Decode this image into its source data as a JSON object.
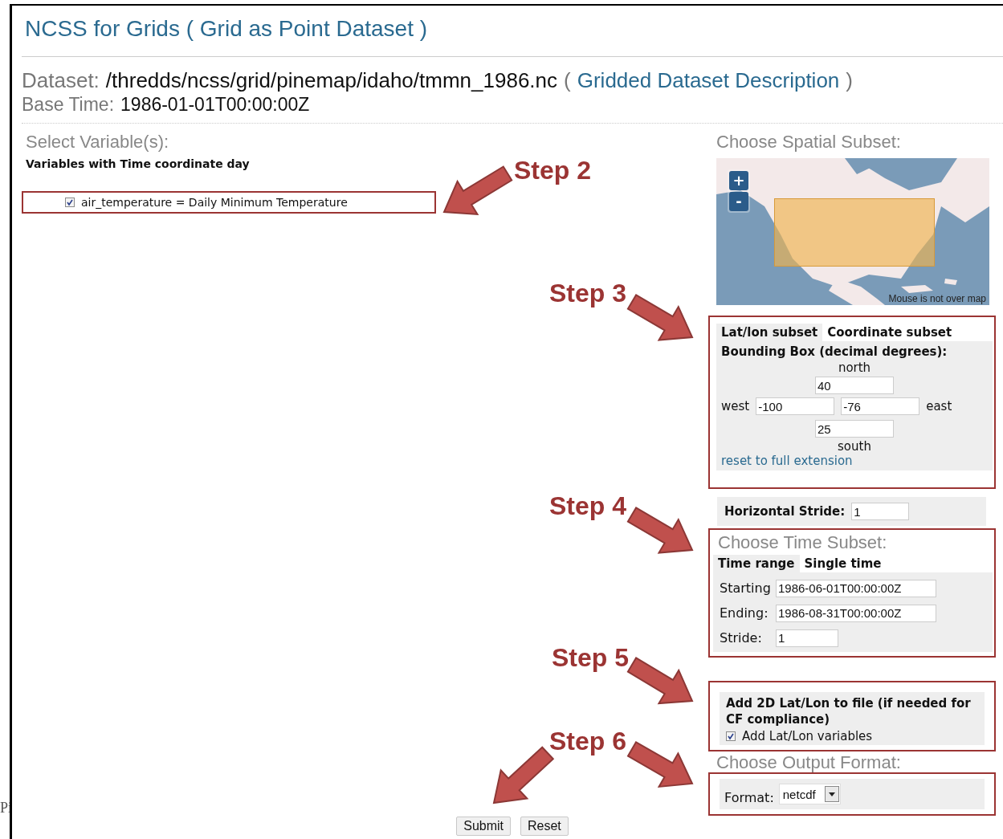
{
  "margin_text": "Pi",
  "header": {
    "title": "NCSS for Grids ( Grid as Point Dataset )",
    "dataset_label": "Dataset:",
    "dataset_path": "/thredds/ncss/grid/pinemap/idaho/tmmn_1986.nc",
    "open": "(",
    "description_link": "Gridded Dataset Description",
    "close": ")",
    "base_time_label": "Base Time:",
    "base_time": "1986-01-01T00:00:00Z"
  },
  "variables": {
    "heading": "Select Variable(s):",
    "group": "Variables with Time coordinate day",
    "items": [
      {
        "label": "air_temperature = Daily Minimum Temperature",
        "checked": true
      }
    ]
  },
  "spatial": {
    "heading": "Choose Spatial Subset:",
    "map": {
      "zoom_in": "+",
      "zoom_out": "-",
      "status": "Mouse is not over map"
    },
    "tabs": [
      {
        "label": "Lat/lon subset",
        "selected": true
      },
      {
        "label": "Coordinate subset",
        "selected": false
      }
    ],
    "bbox_title": "Bounding Box (decimal degrees):",
    "north_label": "north",
    "north": "40",
    "west_label": "west",
    "west": "-100",
    "east": "-76",
    "east_label": "east",
    "south": "25",
    "south_label": "south",
    "reset_link": "reset to full extension"
  },
  "stride": {
    "label": "Horizontal Stride:",
    "value": "1"
  },
  "time": {
    "heading": "Choose Time Subset:",
    "tabs": [
      {
        "label": "Time range",
        "selected": true
      },
      {
        "label": "Single time",
        "selected": false
      }
    ],
    "fields": [
      {
        "label": "Starting",
        "value": "1986-06-01T00:00:00Z"
      },
      {
        "label": "Ending:",
        "value": "1986-08-31T00:00:00Z"
      },
      {
        "label": "Stride:",
        "value": "1"
      }
    ]
  },
  "latlon": {
    "title": "Add 2D Lat/Lon to file (if needed for CF compliance)",
    "label": "Add Lat/Lon variables",
    "checked": true
  },
  "output": {
    "heading": "Choose Output Format:",
    "format_label": "Format:",
    "format": "netcdf"
  },
  "buttons": [
    "Submit",
    "Reset"
  ],
  "steps": [
    {
      "label": "Step 2"
    },
    {
      "label": "Step 3"
    },
    {
      "label": "Step 4"
    },
    {
      "label": "Step 5"
    },
    {
      "label": "Step 6"
    }
  ]
}
